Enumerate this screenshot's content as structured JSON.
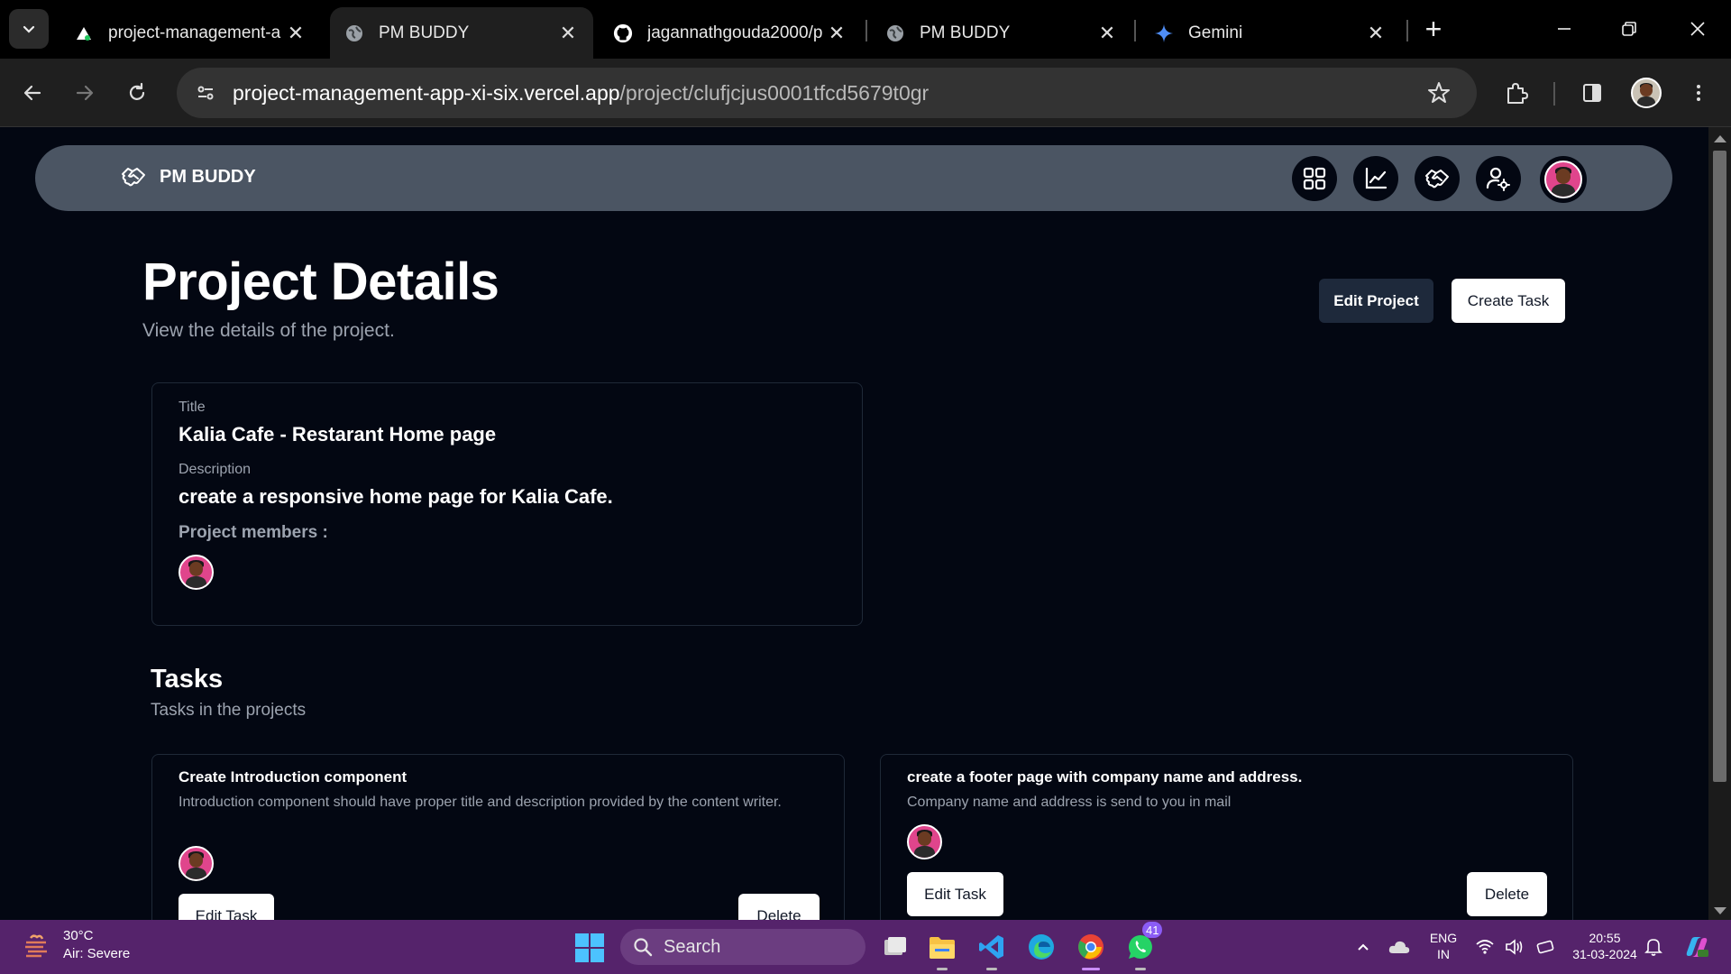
{
  "browser": {
    "tabs": [
      {
        "title": "project-management-a",
        "icon": "vercel-icon",
        "active": false
      },
      {
        "title": "PM BUDDY",
        "icon": "globe-icon",
        "active": true
      },
      {
        "title": "jagannathgouda2000/p",
        "icon": "github-icon",
        "active": false
      },
      {
        "title": "PM BUDDY",
        "icon": "globe-icon",
        "active": false
      },
      {
        "title": "Gemini",
        "icon": "gemini-icon",
        "active": false
      }
    ],
    "url_host": "project-management-app-xi-six.vercel.app",
    "url_path": "/project/clufjcjus0001tfcd5679t0gr"
  },
  "app": {
    "brand": "PM BUDDY",
    "nav_icons": [
      "dashboard-icon",
      "analytics-icon",
      "handshake-icon",
      "user-settings-icon"
    ]
  },
  "page": {
    "title": "Project Details",
    "subtitle": "View the details of the project.",
    "edit_project_label": "Edit Project",
    "create_task_label": "Create Task"
  },
  "project": {
    "title_label": "Title",
    "title": "Kalia Cafe - Restarant Home page",
    "description_label": "Description",
    "description": "create a responsive home page for Kalia Cafe.",
    "members_label": "Project members :"
  },
  "tasks_section": {
    "heading": "Tasks",
    "subheading": "Tasks in the projects",
    "items": [
      {
        "title": "Create Introduction component",
        "description": "Introduction component should have proper title and description provided by the content writer.",
        "edit_label": "Edit Task",
        "delete_label": "Delete"
      },
      {
        "title": "create a footer page with company name and address.",
        "description": "Company name and address is send to you in mail",
        "edit_label": "Edit Task",
        "delete_label": "Delete"
      }
    ]
  },
  "taskbar": {
    "weather_temp": "30°C",
    "weather_desc": "Air: Severe",
    "search_placeholder": "Search",
    "whatsapp_badge": "41",
    "lang_line1": "ENG",
    "lang_line2": "IN",
    "time": "20:55",
    "date": "31-03-2024"
  },
  "colors": {
    "page_bg": "#030712",
    "nav_bg": "#4b5563",
    "taskbar_bg": "#55236b",
    "avatar_bg": "#e0458c"
  }
}
